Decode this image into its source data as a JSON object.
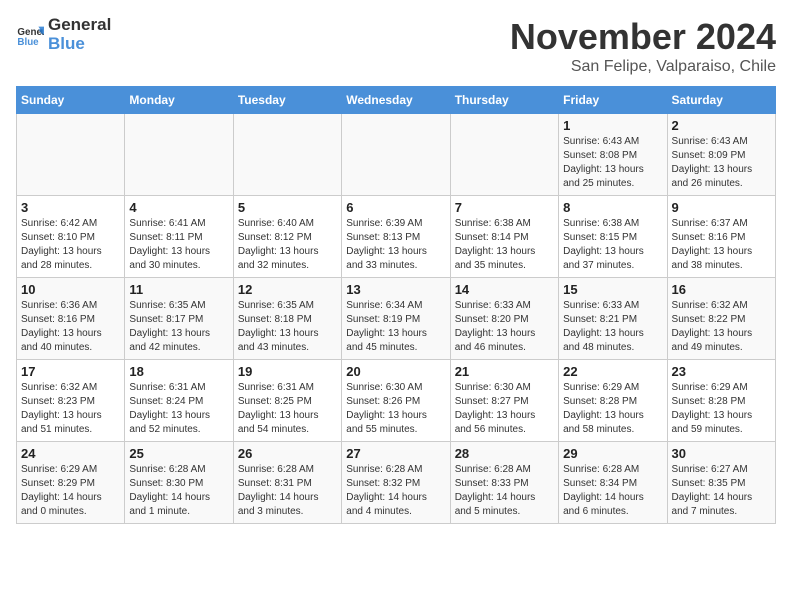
{
  "logo": {
    "text_general": "General",
    "text_blue": "Blue"
  },
  "title": "November 2024",
  "location": "San Felipe, Valparaiso, Chile",
  "days_of_week": [
    "Sunday",
    "Monday",
    "Tuesday",
    "Wednesday",
    "Thursday",
    "Friday",
    "Saturday"
  ],
  "weeks": [
    [
      {
        "day": "",
        "info": ""
      },
      {
        "day": "",
        "info": ""
      },
      {
        "day": "",
        "info": ""
      },
      {
        "day": "",
        "info": ""
      },
      {
        "day": "",
        "info": ""
      },
      {
        "day": "1",
        "info": "Sunrise: 6:43 AM\nSunset: 8:08 PM\nDaylight: 13 hours and 25 minutes."
      },
      {
        "day": "2",
        "info": "Sunrise: 6:43 AM\nSunset: 8:09 PM\nDaylight: 13 hours and 26 minutes."
      }
    ],
    [
      {
        "day": "3",
        "info": "Sunrise: 6:42 AM\nSunset: 8:10 PM\nDaylight: 13 hours and 28 minutes."
      },
      {
        "day": "4",
        "info": "Sunrise: 6:41 AM\nSunset: 8:11 PM\nDaylight: 13 hours and 30 minutes."
      },
      {
        "day": "5",
        "info": "Sunrise: 6:40 AM\nSunset: 8:12 PM\nDaylight: 13 hours and 32 minutes."
      },
      {
        "day": "6",
        "info": "Sunrise: 6:39 AM\nSunset: 8:13 PM\nDaylight: 13 hours and 33 minutes."
      },
      {
        "day": "7",
        "info": "Sunrise: 6:38 AM\nSunset: 8:14 PM\nDaylight: 13 hours and 35 minutes."
      },
      {
        "day": "8",
        "info": "Sunrise: 6:38 AM\nSunset: 8:15 PM\nDaylight: 13 hours and 37 minutes."
      },
      {
        "day": "9",
        "info": "Sunrise: 6:37 AM\nSunset: 8:16 PM\nDaylight: 13 hours and 38 minutes."
      }
    ],
    [
      {
        "day": "10",
        "info": "Sunrise: 6:36 AM\nSunset: 8:16 PM\nDaylight: 13 hours and 40 minutes."
      },
      {
        "day": "11",
        "info": "Sunrise: 6:35 AM\nSunset: 8:17 PM\nDaylight: 13 hours and 42 minutes."
      },
      {
        "day": "12",
        "info": "Sunrise: 6:35 AM\nSunset: 8:18 PM\nDaylight: 13 hours and 43 minutes."
      },
      {
        "day": "13",
        "info": "Sunrise: 6:34 AM\nSunset: 8:19 PM\nDaylight: 13 hours and 45 minutes."
      },
      {
        "day": "14",
        "info": "Sunrise: 6:33 AM\nSunset: 8:20 PM\nDaylight: 13 hours and 46 minutes."
      },
      {
        "day": "15",
        "info": "Sunrise: 6:33 AM\nSunset: 8:21 PM\nDaylight: 13 hours and 48 minutes."
      },
      {
        "day": "16",
        "info": "Sunrise: 6:32 AM\nSunset: 8:22 PM\nDaylight: 13 hours and 49 minutes."
      }
    ],
    [
      {
        "day": "17",
        "info": "Sunrise: 6:32 AM\nSunset: 8:23 PM\nDaylight: 13 hours and 51 minutes."
      },
      {
        "day": "18",
        "info": "Sunrise: 6:31 AM\nSunset: 8:24 PM\nDaylight: 13 hours and 52 minutes."
      },
      {
        "day": "19",
        "info": "Sunrise: 6:31 AM\nSunset: 8:25 PM\nDaylight: 13 hours and 54 minutes."
      },
      {
        "day": "20",
        "info": "Sunrise: 6:30 AM\nSunset: 8:26 PM\nDaylight: 13 hours and 55 minutes."
      },
      {
        "day": "21",
        "info": "Sunrise: 6:30 AM\nSunset: 8:27 PM\nDaylight: 13 hours and 56 minutes."
      },
      {
        "day": "22",
        "info": "Sunrise: 6:29 AM\nSunset: 8:28 PM\nDaylight: 13 hours and 58 minutes."
      },
      {
        "day": "23",
        "info": "Sunrise: 6:29 AM\nSunset: 8:28 PM\nDaylight: 13 hours and 59 minutes."
      }
    ],
    [
      {
        "day": "24",
        "info": "Sunrise: 6:29 AM\nSunset: 8:29 PM\nDaylight: 14 hours and 0 minutes."
      },
      {
        "day": "25",
        "info": "Sunrise: 6:28 AM\nSunset: 8:30 PM\nDaylight: 14 hours and 1 minute."
      },
      {
        "day": "26",
        "info": "Sunrise: 6:28 AM\nSunset: 8:31 PM\nDaylight: 14 hours and 3 minutes."
      },
      {
        "day": "27",
        "info": "Sunrise: 6:28 AM\nSunset: 8:32 PM\nDaylight: 14 hours and 4 minutes."
      },
      {
        "day": "28",
        "info": "Sunrise: 6:28 AM\nSunset: 8:33 PM\nDaylight: 14 hours and 5 minutes."
      },
      {
        "day": "29",
        "info": "Sunrise: 6:28 AM\nSunset: 8:34 PM\nDaylight: 14 hours and 6 minutes."
      },
      {
        "day": "30",
        "info": "Sunrise: 6:27 AM\nSunset: 8:35 PM\nDaylight: 14 hours and 7 minutes."
      }
    ]
  ]
}
